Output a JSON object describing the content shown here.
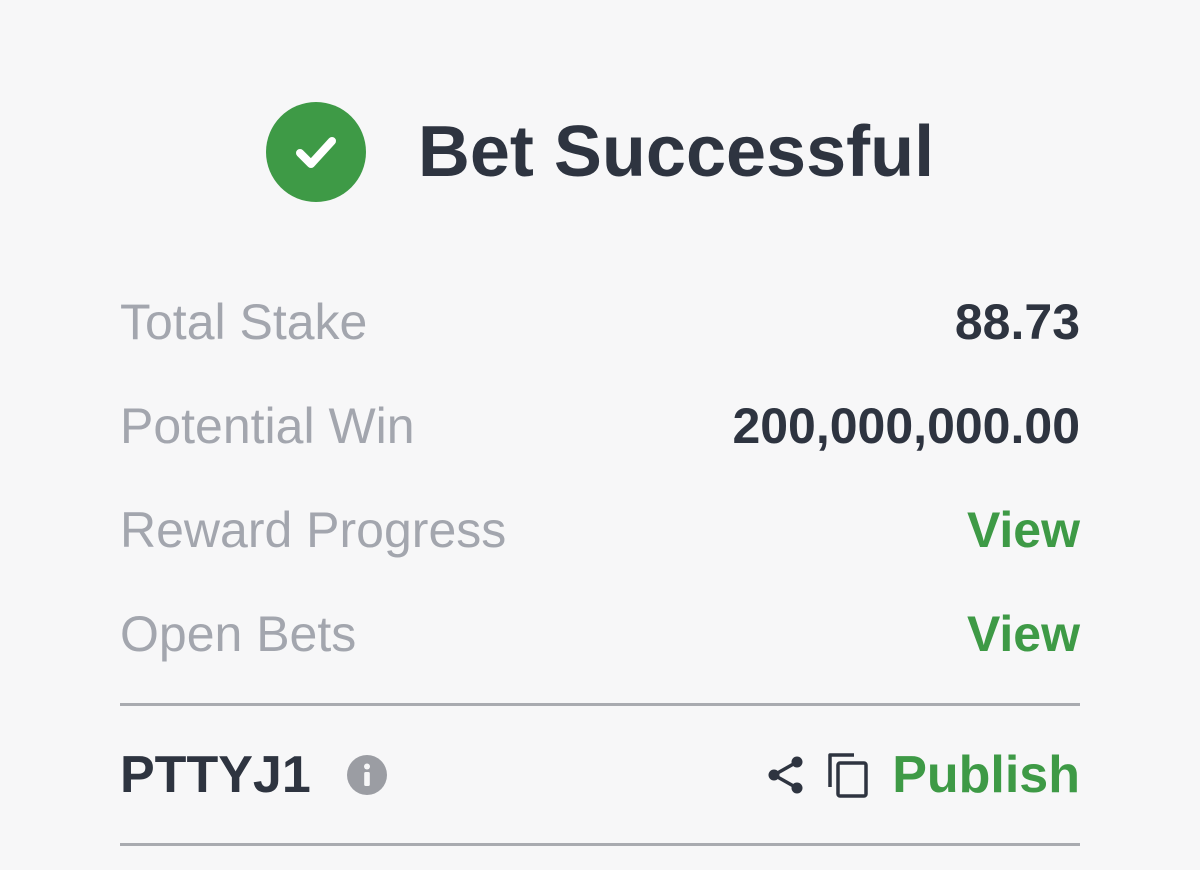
{
  "header": {
    "title": "Bet Successful",
    "icon": "check-circle-icon"
  },
  "summary": {
    "rows": [
      {
        "label": "Total Stake",
        "value": "88.73"
      },
      {
        "label": "Potential Win",
        "value": "200,000,000.00"
      },
      {
        "label": "Reward Progress",
        "value": "View"
      },
      {
        "label": "Open Bets",
        "value": "View"
      }
    ]
  },
  "booking": {
    "code": "PTTYJ1",
    "info_icon": "info-icon",
    "share_icon": "share-icon",
    "copy_icon": "copy-icon",
    "publish_label": "Publish"
  },
  "colors": {
    "accent_green": "#3e9a46",
    "text_dark": "#2e3440",
    "text_muted": "#a3a6ae",
    "background": "#f7f7f8"
  }
}
